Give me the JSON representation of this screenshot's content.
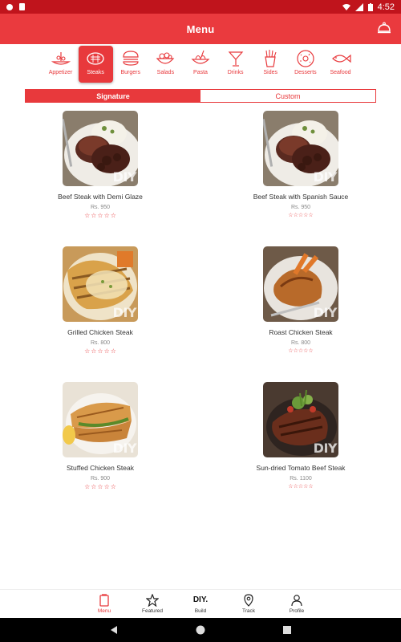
{
  "status_bar": {
    "time": "4:52"
  },
  "app_bar": {
    "title": "Menu"
  },
  "categories": [
    {
      "label": "Appetizer",
      "icon": "appetizer-icon"
    },
    {
      "label": "Steaks",
      "icon": "steak-icon",
      "active": true
    },
    {
      "label": "Burgers",
      "icon": "burger-icon"
    },
    {
      "label": "Salads",
      "icon": "salad-icon"
    },
    {
      "label": "Pasta",
      "icon": "pasta-icon"
    },
    {
      "label": "Drinks",
      "icon": "cocktail-icon"
    },
    {
      "label": "Sides",
      "icon": "fries-icon"
    },
    {
      "label": "Desserts",
      "icon": "donut-icon"
    },
    {
      "label": "Seafood",
      "icon": "fish-icon"
    }
  ],
  "tabs": {
    "signature": "Signature",
    "custom": "Custom",
    "active": "signature"
  },
  "items": [
    {
      "name": "Beef Steak with Demi Glaze",
      "price": "Rs. 950",
      "rating": 0
    },
    {
      "name": "Beef Steak with Spanish Sauce",
      "price": "Rs. 950",
      "rating": 0
    },
    {
      "name": "Grilled Chicken Steak",
      "price": "Rs. 800",
      "rating": 0
    },
    {
      "name": "Roast Chicken Steak",
      "price": "Rs. 800",
      "rating": 0
    },
    {
      "name": "Stuffed Chicken Steak",
      "price": "Rs. 900",
      "rating": 0
    },
    {
      "name": "Sun-dried Tomato Beef Steak",
      "price": "Rs. 1100",
      "rating": 0
    }
  ],
  "watermark": "DIY",
  "bottom_nav": {
    "menu": "Menu",
    "featured": "Featured",
    "build": "Build",
    "track": "Track",
    "profile": "Profile",
    "build_logo": "DIY."
  },
  "colors": {
    "primary": "#ea3a3e",
    "status_bar": "#c0141c",
    "accent": "#e8393c"
  }
}
